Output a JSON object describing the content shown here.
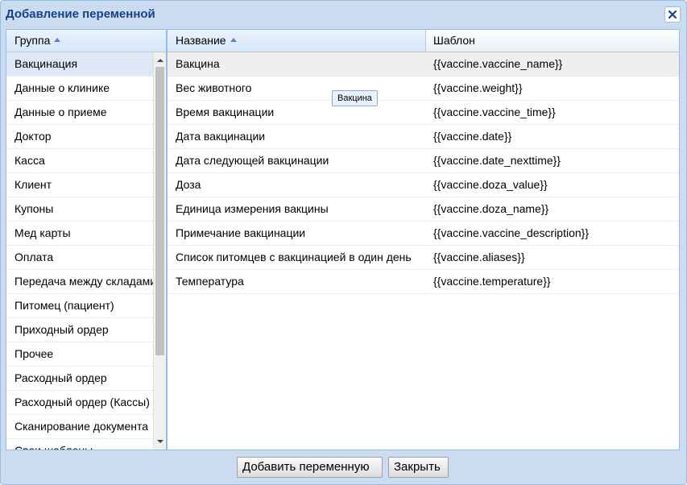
{
  "window": {
    "title": "Добавление переменной"
  },
  "groups_panel": {
    "header": "Группа",
    "items": [
      "Вакцинация",
      "Данные о клинике",
      "Данные о приеме",
      "Доктор",
      "Касса",
      "Клиент",
      "Купоны",
      "Мед карты",
      "Оплата",
      "Передача между складами",
      "Питомец (пациент)",
      "Приходный ордер",
      "Прочее",
      "Расходный ордер",
      "Расходный ордер (Кассы)",
      "Сканирование документа",
      "Свои шаблоны"
    ]
  },
  "variables_table": {
    "columns": [
      "Название",
      "Шаблон"
    ],
    "rows": [
      {
        "name": "Вакцина",
        "template": "{{vaccine.vaccine_name}}"
      },
      {
        "name": "Вес животного",
        "template": "{{vaccine.weight}}"
      },
      {
        "name": "Время вакцинации",
        "template": "{{vaccine.vaccine_time}}"
      },
      {
        "name": "Дата вакцинации",
        "template": "{{vaccine.date}}"
      },
      {
        "name": "Дата следующей вакцинации",
        "template": "{{vaccine.date_nexttime}}"
      },
      {
        "name": "Доза",
        "template": "{{vaccine.doza_value}}"
      },
      {
        "name": "Единица измерения вакцины",
        "template": "{{vaccine.doza_name}}"
      },
      {
        "name": "Примечание вакцинации",
        "template": "{{vaccine.vaccine_description}}"
      },
      {
        "name": "Список питомцев с вакцинацией в один день",
        "template": "{{vaccine.aliases}}"
      },
      {
        "name": "Температура",
        "template": "{{vaccine.temperature}}"
      }
    ]
  },
  "tooltip": "Вакцина",
  "buttons": {
    "add": "Добавить переменную",
    "close": "Закрыть"
  },
  "colors": {
    "title": "#15428b",
    "border": "#99bbe8",
    "selected_row": "#dfe8f6",
    "window_bg": "#cbdcf1"
  }
}
